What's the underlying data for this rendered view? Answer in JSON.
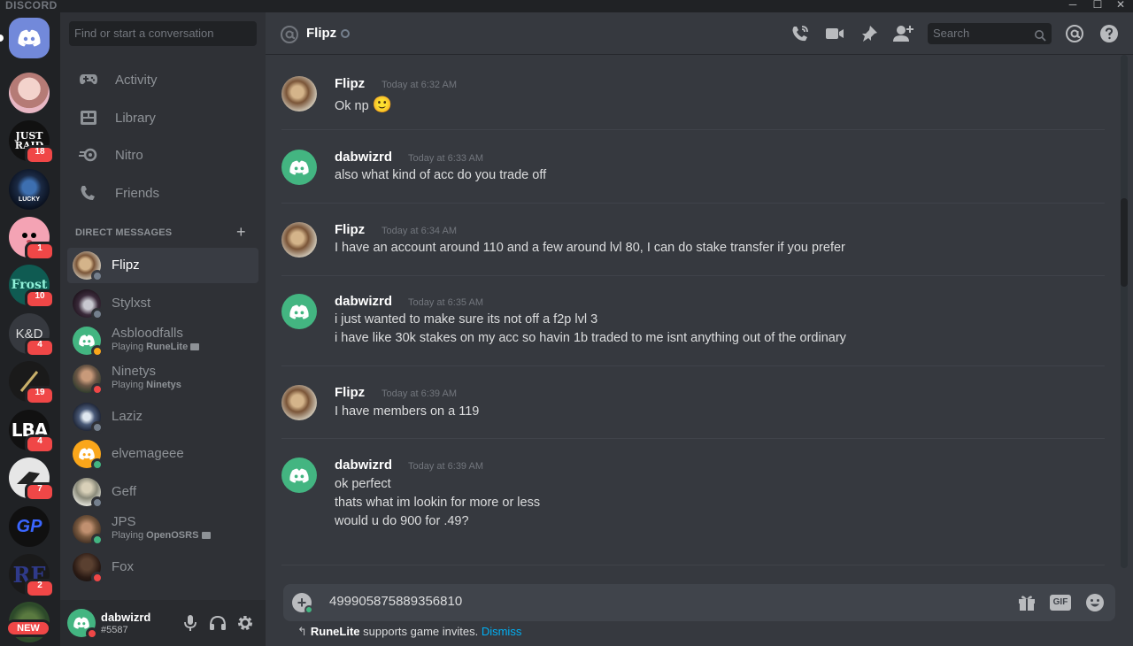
{
  "window": {
    "brand": "DISCORD",
    "controls": [
      "─",
      "☐",
      "✕"
    ]
  },
  "servers": [
    {
      "name": "home",
      "color": "#7289da",
      "label": ""
    },
    {
      "name": "server-1",
      "color": "#d9a6b4",
      "label": "",
      "badge": ""
    },
    {
      "name": "server-2",
      "color": "#111111",
      "label": "JUST RAIDING",
      "badge": "18"
    },
    {
      "name": "server-3",
      "color": "#1b2a44",
      "label": "LUCKY",
      "badge": ""
    },
    {
      "name": "server-4",
      "color": "#f4a3b4",
      "label": "",
      "badge": "1"
    },
    {
      "name": "server-5",
      "color": "#0f5b52",
      "label": "Frost",
      "badge": "10"
    },
    {
      "name": "server-6",
      "color": "#36393f",
      "label": "K&D",
      "badge": "4"
    },
    {
      "name": "server-7",
      "color": "#1a1a1a",
      "label": "",
      "badge": "19"
    },
    {
      "name": "server-8",
      "color": "#111111",
      "label": "LBA",
      "badge": "4"
    },
    {
      "name": "server-9",
      "color": "#e6e6e6",
      "label": "",
      "badge": "7"
    },
    {
      "name": "server-10",
      "color": "#101010",
      "label": "GP",
      "badge": ""
    },
    {
      "name": "server-11",
      "color": "#1a1a1a",
      "label": "RF",
      "badge": "2"
    },
    {
      "name": "server-12",
      "color": "#2d4a2a",
      "label": "",
      "badge": ""
    }
  ],
  "new_badge": "NEW",
  "sidebar": {
    "search_placeholder": "Find or start a conversation",
    "nav": [
      {
        "label": "Activity",
        "icon": "gamepad-icon"
      },
      {
        "label": "Library",
        "icon": "library-icon"
      },
      {
        "label": "Nitro",
        "icon": "nitro-icon"
      },
      {
        "label": "Friends",
        "icon": "friends-icon"
      }
    ],
    "dm_header": "DIRECT MESSAGES",
    "dm_add": "+",
    "dms": [
      {
        "name": "Flipz",
        "status": "offline",
        "sub_prefix": "",
        "sub_game": "",
        "color": "#8a6b4e",
        "active": true
      },
      {
        "name": "Stylxst",
        "status": "offline",
        "sub_prefix": "",
        "sub_game": "",
        "color": "#3a2a3a"
      },
      {
        "name": "Asbloodfalls",
        "status": "idle",
        "sub_prefix": "Playing ",
        "sub_game": "RuneLite",
        "color": "#43b581"
      },
      {
        "name": "Ninetys",
        "status": "dnd",
        "sub_prefix": "Playing ",
        "sub_game": "Ninetys",
        "color": "#6b5646"
      },
      {
        "name": "Laziz",
        "status": "offline",
        "sub_prefix": "",
        "sub_game": "",
        "color": "#4a5a78"
      },
      {
        "name": "elvemageee",
        "status": "online",
        "sub_prefix": "",
        "sub_game": "",
        "color": "#faa61a"
      },
      {
        "name": "Geff",
        "status": "offline",
        "sub_prefix": "",
        "sub_game": "",
        "color": "#8a8a7a"
      },
      {
        "name": "JPS",
        "status": "online",
        "sub_prefix": "Playing ",
        "sub_game": "OpenOSRS",
        "color": "#7a5a40"
      },
      {
        "name": "Fox",
        "status": "dnd",
        "sub_prefix": "",
        "sub_game": "",
        "color": "#3a2a20"
      }
    ],
    "user": {
      "name": "dabwizrd",
      "tag": "#5587",
      "color": "#43b581"
    }
  },
  "chat": {
    "title": "Flipz",
    "search_placeholder": "Search",
    "messages": [
      {
        "author": "Flipz",
        "time": "Today at 6:32 AM",
        "lines": [
          "Ok np"
        ],
        "avatar": "photo",
        "emoji": "🙂"
      },
      {
        "author": "dabwizrd",
        "time": "Today at 6:33 AM",
        "lines": [
          "also what kind of acc do you trade off"
        ],
        "avatar": "discord"
      },
      {
        "author": "Flipz",
        "time": "Today at 6:34 AM",
        "lines": [
          "I have an account around 110 and a few around lvl 80, I can do stake transfer if you prefer"
        ],
        "avatar": "photo"
      },
      {
        "author": "dabwizrd",
        "time": "Today at 6:35 AM",
        "lines": [
          "i just wanted to make sure its not off a f2p lvl 3",
          "i have like 30k stakes on my acc so havin 1b traded to me isnt anything out of the ordinary"
        ],
        "avatar": "discord"
      },
      {
        "author": "Flipz",
        "time": "Today at 6:39 AM",
        "lines": [
          "I have members on a 119"
        ],
        "avatar": "photo"
      },
      {
        "author": "dabwizrd",
        "time": "Today at 6:39 AM",
        "lines": [
          "ok perfect",
          "thats what im lookin for more or less",
          "would u do 900 for .49?"
        ],
        "avatar": "discord"
      }
    ],
    "composer_value": "499905875889356810",
    "gif_label": "GIF",
    "invite": {
      "game": "RuneLite",
      "text": " supports game invites. ",
      "dismiss": "Dismiss"
    }
  },
  "colors": {
    "blurple": "#7289da",
    "green": "#43b581",
    "red": "#f04747",
    "link": "#00b0f4"
  }
}
